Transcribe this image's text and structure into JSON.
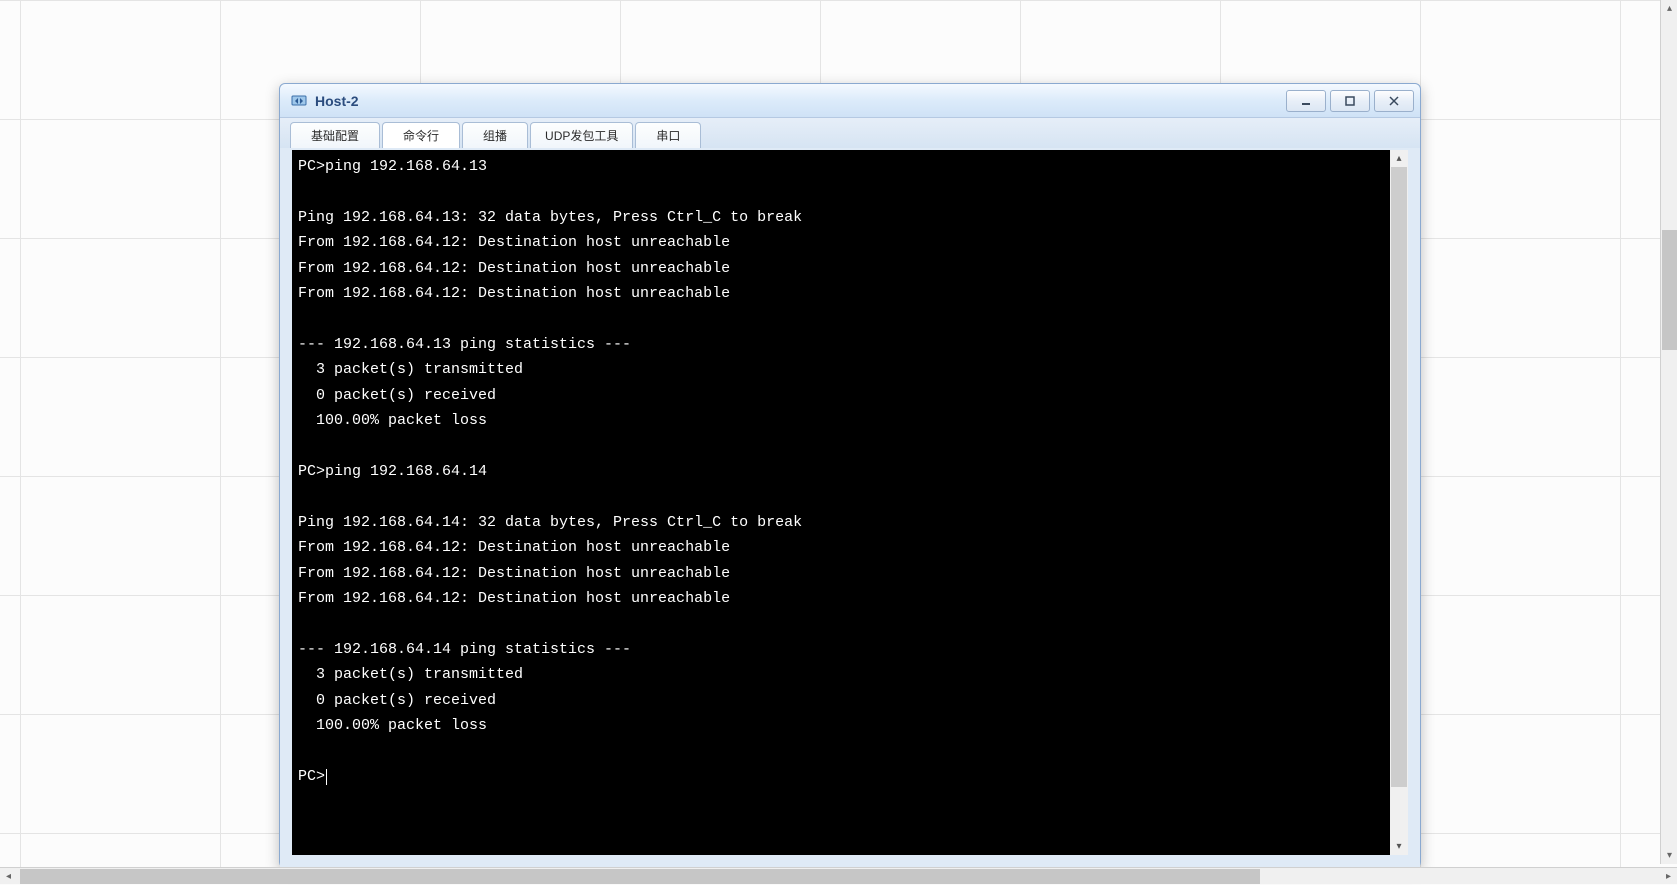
{
  "window": {
    "title": "Host-2",
    "tabs": [
      {
        "label": "基础配置"
      },
      {
        "label": "命令行"
      },
      {
        "label": "组播"
      },
      {
        "label": "UDP发包工具"
      },
      {
        "label": "串口"
      }
    ],
    "active_tab_index": 1
  },
  "terminal": {
    "lines": [
      "PC>ping 192.168.64.13",
      "",
      "Ping 192.168.64.13: 32 data bytes, Press Ctrl_C to break",
      "From 192.168.64.12: Destination host unreachable",
      "From 192.168.64.12: Destination host unreachable",
      "From 192.168.64.12: Destination host unreachable",
      "",
      "--- 192.168.64.13 ping statistics ---",
      "  3 packet(s) transmitted",
      "  0 packet(s) received",
      "  100.00% packet loss",
      "",
      "PC>ping 192.168.64.14",
      "",
      "Ping 192.168.64.14: 32 data bytes, Press Ctrl_C to break",
      "From 192.168.64.12: Destination host unreachable",
      "From 192.168.64.12: Destination host unreachable",
      "From 192.168.64.12: Destination host unreachable",
      "",
      "--- 192.168.64.14 ping statistics ---",
      "  3 packet(s) transmitted",
      "  0 packet(s) received",
      "  100.00% packet loss",
      "",
      "PC>"
    ]
  }
}
